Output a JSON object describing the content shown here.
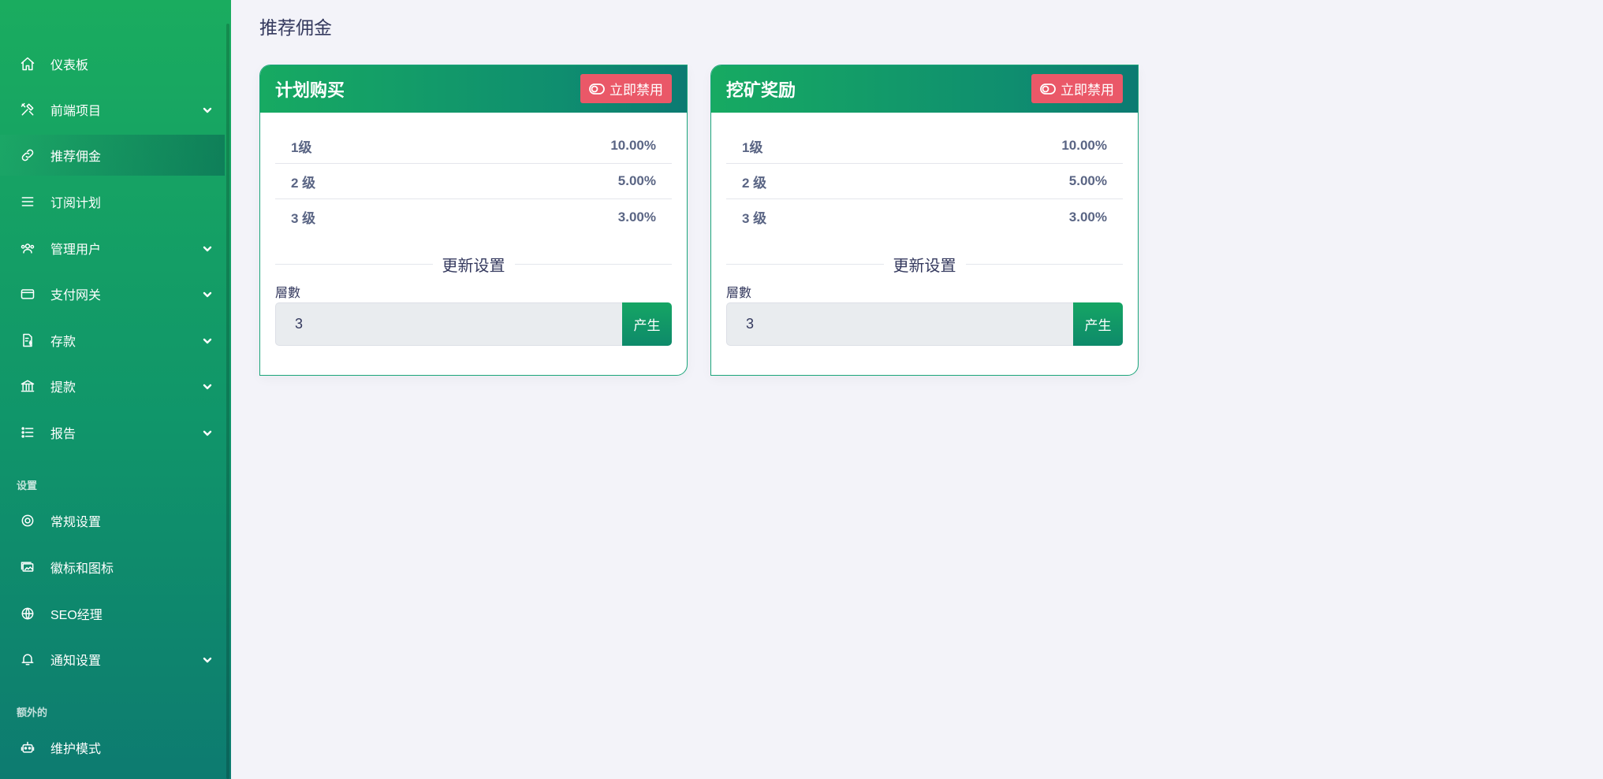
{
  "sidebar": {
    "items": [
      {
        "label": "仪表板",
        "icon": "home-icon",
        "has_caret": false,
        "active": false
      },
      {
        "label": "前端项目",
        "icon": "tools-icon",
        "has_caret": true,
        "active": false
      },
      {
        "label": "推荐佣金",
        "icon": "link-icon",
        "has_caret": false,
        "active": true
      },
      {
        "label": "订阅计划",
        "icon": "list-icon",
        "has_caret": false,
        "active": false
      },
      {
        "label": "管理用户",
        "icon": "users-icon",
        "has_caret": true,
        "active": false
      },
      {
        "label": "支付网关",
        "icon": "credit-card-icon",
        "has_caret": true,
        "active": false
      },
      {
        "label": "存款",
        "icon": "file-invoice-dollar-icon",
        "has_caret": true,
        "active": false
      },
      {
        "label": "提款",
        "icon": "bank-icon",
        "has_caret": true,
        "active": false
      },
      {
        "label": "报告",
        "icon": "list-ul-icon",
        "has_caret": true,
        "active": false
      }
    ],
    "section_settings": "设置",
    "settings_items": [
      {
        "label": "常规设置",
        "icon": "life-ring-icon",
        "has_caret": false
      },
      {
        "label": "徽标和图标",
        "icon": "images-icon",
        "has_caret": false
      },
      {
        "label": "SEO经理",
        "icon": "globe-icon",
        "has_caret": false
      },
      {
        "label": "通知设置",
        "icon": "bell-icon",
        "has_caret": true
      }
    ],
    "section_extra": "额外的",
    "extra_items": [
      {
        "label": "维护模式",
        "icon": "robot-icon",
        "has_caret": false
      }
    ]
  },
  "page": {
    "title": "推荐佣金"
  },
  "cards": [
    {
      "title": "计划购买",
      "disable_label": "立即禁用",
      "levels": [
        {
          "label": "1级",
          "value": "10.00%"
        },
        {
          "label": "2 级",
          "value": "5.00%"
        },
        {
          "label": "3 级",
          "value": "3.00%"
        }
      ],
      "update_title": "更新设置",
      "layer_label": "層數",
      "layer_value": "3",
      "generate_label": "产生"
    },
    {
      "title": "挖矿奖励",
      "disable_label": "立即禁用",
      "levels": [
        {
          "label": "1级",
          "value": "10.00%"
        },
        {
          "label": "2 级",
          "value": "5.00%"
        },
        {
          "label": "3 级",
          "value": "3.00%"
        }
      ],
      "update_title": "更新设置",
      "layer_label": "層數",
      "layer_value": "3",
      "generate_label": "产生"
    }
  ],
  "colors": {
    "sidebar_top": "#1aac5f",
    "sidebar_bottom": "#0d7b70",
    "danger": "#ea5868",
    "accent": "#15a564"
  }
}
